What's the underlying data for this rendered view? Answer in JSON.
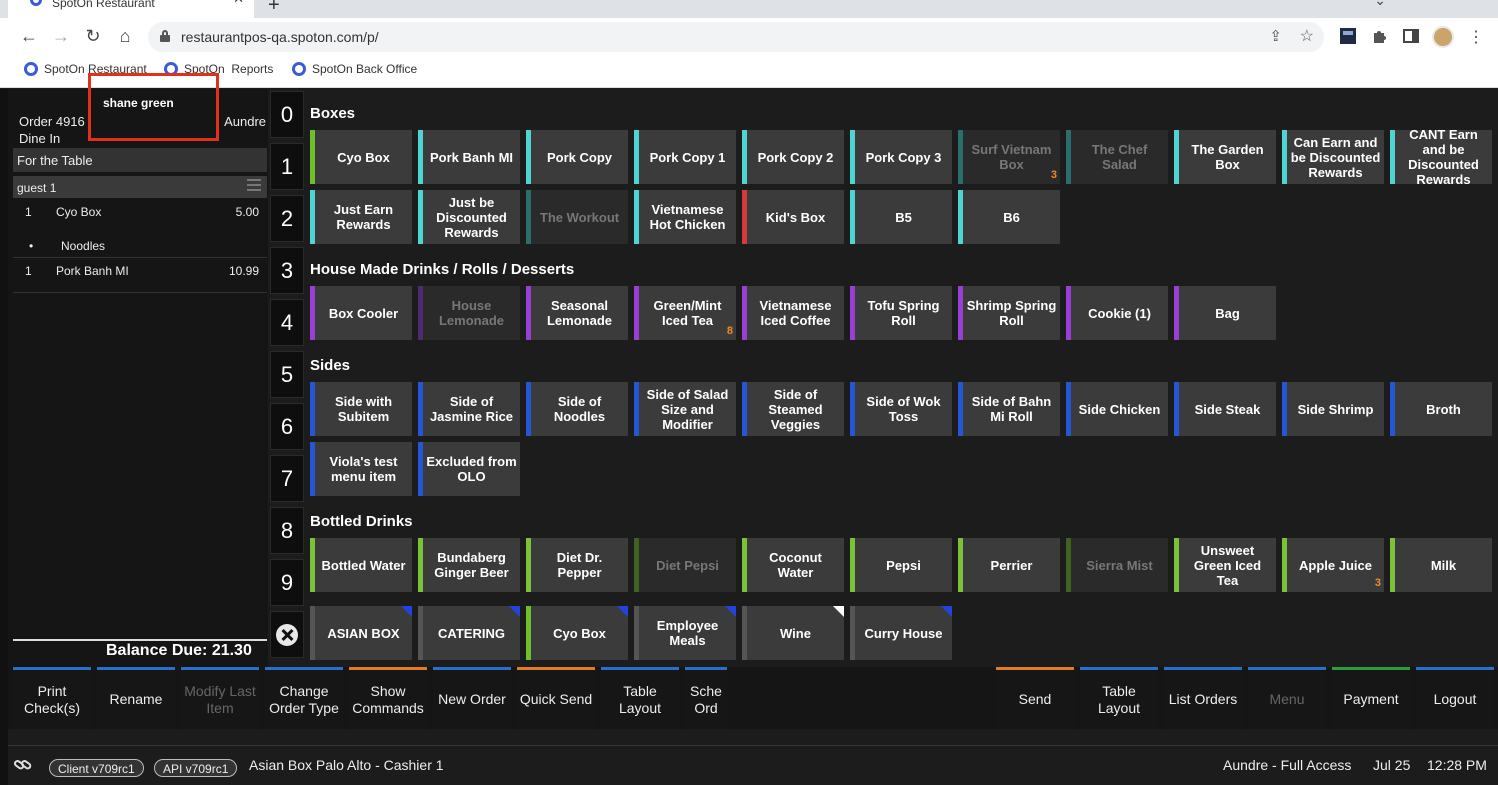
{
  "browser": {
    "tab_title": "SpotOn Restaurant",
    "url": "restaurantpos-qa.spoton.com/p/",
    "bookmarks": [
      "SpotOn Restaurant",
      "SpotOn  Reports",
      "SpotOn Back Office"
    ]
  },
  "order": {
    "order_number": "Order 4916",
    "order_type": "Dine In",
    "server": "Aundre",
    "customer_name": "shane green",
    "for_table_label": "For the Table",
    "guest_label": "guest 1",
    "items": [
      {
        "qty": "1",
        "name": "Cyo Box",
        "price": "5.00",
        "modifiers": [
          "Noodles"
        ]
      },
      {
        "qty": "1",
        "name": "Pork Banh MI",
        "price": "10.99",
        "modifiers": []
      }
    ],
    "modifier_bullet": "•",
    "balance_due": "Balance Due: 21.30"
  },
  "number_keys": [
    "0",
    "1",
    "2",
    "3",
    "4",
    "5",
    "6",
    "7",
    "8",
    "9"
  ],
  "sections": {
    "boxes": {
      "title": "Boxes",
      "items": [
        {
          "label": "Cyo Box",
          "color": "#6fbf2a",
          "disabled": false
        },
        {
          "label": "Pork Banh MI",
          "color": "#4fd4d4",
          "disabled": false
        },
        {
          "label": "Pork Copy",
          "color": "#4fd4d4",
          "disabled": false
        },
        {
          "label": "Pork Copy 1",
          "color": "#4fd4d4",
          "disabled": false
        },
        {
          "label": "Pork Copy 2",
          "color": "#4fd4d4",
          "disabled": false
        },
        {
          "label": "Pork Copy 3",
          "color": "#4fd4d4",
          "disabled": false
        },
        {
          "label": "Surf Vietnam Box",
          "color": "#2a6e6e",
          "disabled": true,
          "count": "3"
        },
        {
          "label": "The Chef Salad",
          "color": "#2a6e6e",
          "disabled": true
        },
        {
          "label": "The Garden Box",
          "color": "#4fd4d4",
          "disabled": false
        },
        {
          "label": "Can Earn and be Discounted Rewards",
          "color": "#4fd4d4",
          "disabled": false
        },
        {
          "label": "CANT Earn and be Discounted Rewards",
          "color": "#4fd4d4",
          "disabled": false
        },
        {
          "label": "Just Earn Rewards",
          "color": "#4fd4d4",
          "disabled": false
        },
        {
          "label": "Just be Discounted Rewards",
          "color": "#4fd4d4",
          "disabled": false
        },
        {
          "label": "The Workout",
          "color": "#2a6e6e",
          "disabled": true
        },
        {
          "label": "Vietnamese Hot Chicken",
          "color": "#4fd4d4",
          "disabled": false
        },
        {
          "label": "Kid's Box",
          "color": "#d63a3a",
          "disabled": false
        },
        {
          "label": "B5",
          "color": "#4fd4d4",
          "disabled": false
        },
        {
          "label": "B6",
          "color": "#4fd4d4",
          "disabled": false
        }
      ]
    },
    "drinks": {
      "title": "House Made Drinks / Rolls / Desserts",
      "items": [
        {
          "label": "Box Cooler",
          "color": "#9a3fd6",
          "disabled": false
        },
        {
          "label": "House Lemonade",
          "color": "#4e2a6e",
          "disabled": true
        },
        {
          "label": "Seasonal Lemonade",
          "color": "#9a3fd6",
          "disabled": false
        },
        {
          "label": "Green/Mint Iced Tea",
          "color": "#9a3fd6",
          "disabled": false,
          "count": "8"
        },
        {
          "label": "Vietnamese Iced Coffee",
          "color": "#9a3fd6",
          "disabled": false
        },
        {
          "label": "Tofu Spring Roll",
          "color": "#9a3fd6",
          "disabled": false
        },
        {
          "label": "Shrimp Spring Roll",
          "color": "#9a3fd6",
          "disabled": false
        },
        {
          "label": "Cookie (1)",
          "color": "#9a3fd6",
          "disabled": false
        },
        {
          "label": "Bag",
          "color": "#9a3fd6",
          "disabled": false
        }
      ]
    },
    "sides": {
      "title": "Sides",
      "items": [
        {
          "label": "Side with Subitem",
          "color": "#2456d6",
          "disabled": false
        },
        {
          "label": "Side of Jasmine Rice",
          "color": "#2456d6",
          "disabled": false
        },
        {
          "label": "Side of Noodles",
          "color": "#2456d6",
          "disabled": false
        },
        {
          "label": "Side of Salad Size and Modifier",
          "color": "#2456d6",
          "disabled": false
        },
        {
          "label": "Side of Steamed Veggies",
          "color": "#2456d6",
          "disabled": false
        },
        {
          "label": "Side of Wok Toss",
          "color": "#2456d6",
          "disabled": false
        },
        {
          "label": "Side of Bahn Mi Roll",
          "color": "#2456d6",
          "disabled": false
        },
        {
          "label": "Side Chicken",
          "color": "#2456d6",
          "disabled": false
        },
        {
          "label": "Side Steak",
          "color": "#2456d6",
          "disabled": false
        },
        {
          "label": "Side Shrimp",
          "color": "#2456d6",
          "disabled": false
        },
        {
          "label": "Broth",
          "color": "#2456d6",
          "disabled": false
        },
        {
          "label": "Viola's test menu item",
          "color": "#2456d6",
          "disabled": false
        },
        {
          "label": "Excluded from OLO",
          "color": "#2456d6",
          "disabled": false
        }
      ]
    },
    "bottled": {
      "title": "Bottled Drinks",
      "items": [
        {
          "label": "Bottled Water",
          "color": "#7ac23a",
          "disabled": false
        },
        {
          "label": "Bundaberg Ginger Beer",
          "color": "#7ac23a",
          "disabled": false
        },
        {
          "label": "Diet Dr. Pepper",
          "color": "#7ac23a",
          "disabled": false
        },
        {
          "label": "Diet Pepsi",
          "color": "#3e6420",
          "disabled": true
        },
        {
          "label": "Coconut Water",
          "color": "#7ac23a",
          "disabled": false
        },
        {
          "label": "Pepsi",
          "color": "#7ac23a",
          "disabled": false
        },
        {
          "label": "Perrier",
          "color": "#7ac23a",
          "disabled": false
        },
        {
          "label": "Sierra Mist",
          "color": "#3e6420",
          "disabled": true
        },
        {
          "label": "Unsweet Green Iced Tea",
          "color": "#7ac23a",
          "disabled": false
        },
        {
          "label": "Apple Juice",
          "color": "#7ac23a",
          "disabled": false,
          "count": "3"
        },
        {
          "label": "Milk",
          "color": "#7ac23a",
          "disabled": false
        }
      ]
    },
    "categories": {
      "items": [
        {
          "label": "ASIAN BOX",
          "color": "#555555",
          "corner": "#2244dd"
        },
        {
          "label": "CATERING",
          "color": "#555555",
          "corner": "#2244dd"
        },
        {
          "label": "Cyo Box",
          "color": "#6fbf2a",
          "corner": "#2244dd"
        },
        {
          "label": "Employee Meals",
          "color": "#555555",
          "corner": "#2244dd"
        },
        {
          "label": "Wine",
          "color": "#555555",
          "corner": "#ffffff"
        },
        {
          "label": "Curry House",
          "color": "#555555",
          "corner": "#2244dd"
        }
      ]
    }
  },
  "commands": {
    "left": [
      {
        "label": "Print Check(s)",
        "accent": "#2a70c8",
        "disabled": false
      },
      {
        "label": "Rename",
        "accent": "#2a70c8",
        "disabled": false
      },
      {
        "label": "Modify Last Item",
        "accent": "#2a70c8",
        "disabled": true
      },
      {
        "label": "Change Order Type",
        "accent": "#2a70c8",
        "disabled": false
      },
      {
        "label": "Show Commands",
        "accent": "#e07b28",
        "disabled": false
      },
      {
        "label": "New Order",
        "accent": "#2a70c8",
        "disabled": false
      },
      {
        "label": "Quick Send",
        "accent": "#e07b28",
        "disabled": false
      },
      {
        "label": "Table Layout",
        "accent": "#2a70c8",
        "disabled": false
      },
      {
        "label": "Sche Ord",
        "accent": "#2a70c8",
        "disabled": false
      }
    ],
    "right": [
      {
        "label": "Send",
        "accent": "#e07b28",
        "disabled": false
      },
      {
        "label": "Table Layout",
        "accent": "#2a70c8",
        "disabled": false
      },
      {
        "label": "List Orders",
        "accent": "#2a70c8",
        "disabled": false
      },
      {
        "label": "Menu",
        "accent": "#2a70c8",
        "disabled": true
      },
      {
        "label": "Payment",
        "accent": "#2e9b3e",
        "disabled": false
      },
      {
        "label": "Logout",
        "accent": "#2a70c8",
        "disabled": false
      }
    ]
  },
  "status": {
    "client_version": "Client v709rc1",
    "api_version": "API v709rc1",
    "store": "Asian Box Palo Alto - Cashier 1",
    "user_access": "Aundre - Full Access",
    "date": "Jul 25",
    "time": "12:28 PM"
  }
}
